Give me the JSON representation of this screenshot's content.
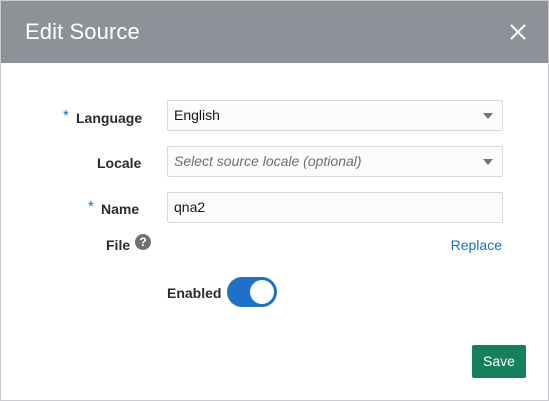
{
  "dialog": {
    "title": "Edit Source",
    "close_icon": "close-icon"
  },
  "form": {
    "language": {
      "label": "Language",
      "required_mark": "*",
      "value": "English"
    },
    "locale": {
      "label": "Locale",
      "placeholder": "Select source locale (optional)"
    },
    "name": {
      "label": "Name",
      "required_mark": "*",
      "value": "qna2"
    },
    "file": {
      "label": "File",
      "help_icon": "help-icon",
      "help_glyph": "?",
      "replace_label": "Replace"
    },
    "enabled": {
      "label": "Enabled",
      "state": "on"
    }
  },
  "footer": {
    "save_label": "Save"
  },
  "colors": {
    "header_bg": "#8f9199",
    "accent": "#1a6fc3",
    "toggle_on": "#1f70c9",
    "primary_button": "#15805a"
  }
}
